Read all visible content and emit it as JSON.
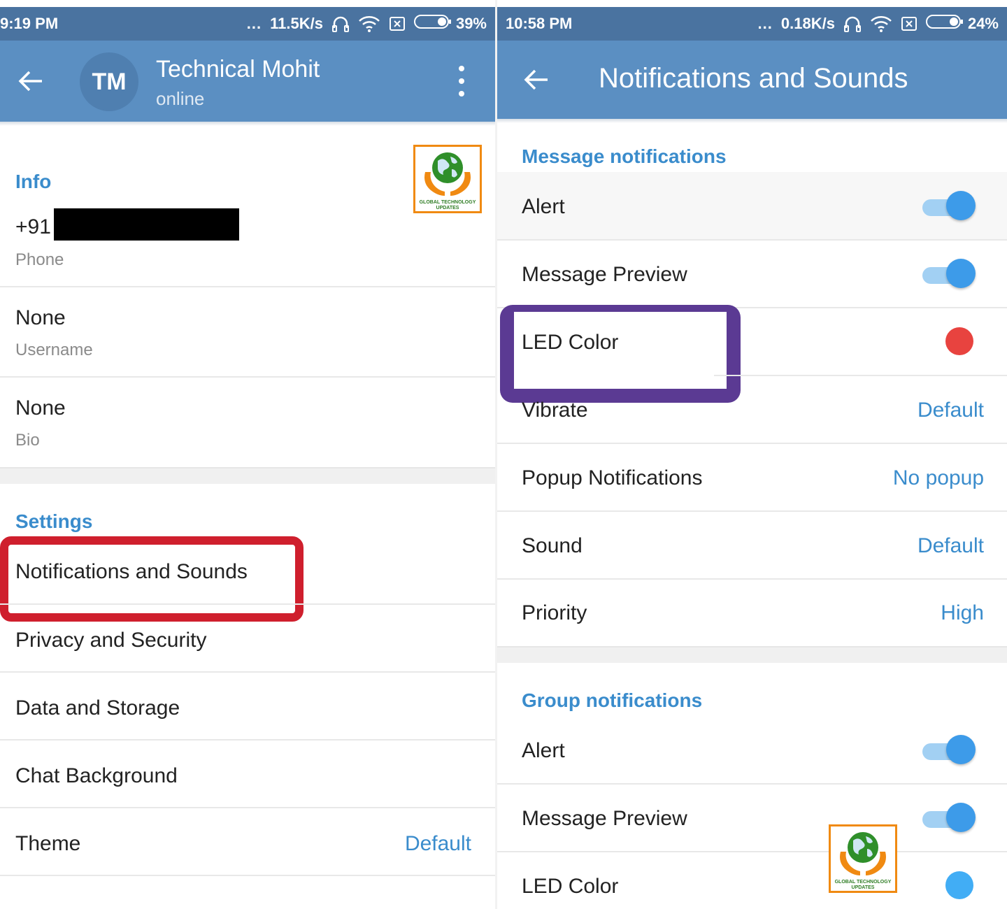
{
  "colors": {
    "status_bar": "#4a73a0",
    "app_bar": "#5b8fc2",
    "accent": "#3a8ccc",
    "red_highlight": "#cf1f2d",
    "purple_highlight": "#5b3a93",
    "led_message": "#e8433f",
    "led_group": "#41adf5",
    "logo_border": "#f08a12"
  },
  "left": {
    "status_bar": {
      "time": "9:19 PM",
      "dots": "...",
      "speed": "11.5K/s",
      "battery": "39%"
    },
    "header": {
      "avatar_initials": "TM",
      "name": "Technical Mohit",
      "status": "online"
    },
    "info": {
      "section_title": "Info",
      "phone_prefix": "+91",
      "phone_label": "Phone",
      "username_value": "None",
      "username_label": "Username",
      "bio_value": "None",
      "bio_label": "Bio"
    },
    "settings": {
      "section_title": "Settings",
      "items": [
        {
          "label": "Notifications and Sounds",
          "value": ""
        },
        {
          "label": "Privacy and Security",
          "value": ""
        },
        {
          "label": "Data and Storage",
          "value": ""
        },
        {
          "label": "Chat Background",
          "value": ""
        },
        {
          "label": "Theme",
          "value": "Default"
        }
      ]
    }
  },
  "right": {
    "status_bar": {
      "time": "10:58 PM",
      "dots": "...",
      "speed": "0.18K/s",
      "battery": "24%"
    },
    "header": {
      "title": "Notifications and Sounds"
    },
    "message_notifications": {
      "section_title": "Message notifications",
      "alert": {
        "label": "Alert",
        "on": true
      },
      "message_preview": {
        "label": "Message Preview",
        "on": true
      },
      "led_color": {
        "label": "LED Color",
        "color": "#e8433f"
      },
      "vibrate": {
        "label": "Vibrate",
        "value": "Default"
      },
      "popup": {
        "label": "Popup Notifications",
        "value": "No popup"
      },
      "sound": {
        "label": "Sound",
        "value": "Default"
      },
      "priority": {
        "label": "Priority",
        "value": "High"
      }
    },
    "group_notifications": {
      "section_title": "Group notifications",
      "alert": {
        "label": "Alert",
        "on": true
      },
      "message_preview": {
        "label": "Message Preview",
        "on": true
      },
      "led_color": {
        "label": "LED Color",
        "color": "#41adf5"
      }
    }
  },
  "watermark": {
    "caption_line1": "GLOBAL TECHNOLOGY",
    "caption_line2": "UPDATES"
  }
}
